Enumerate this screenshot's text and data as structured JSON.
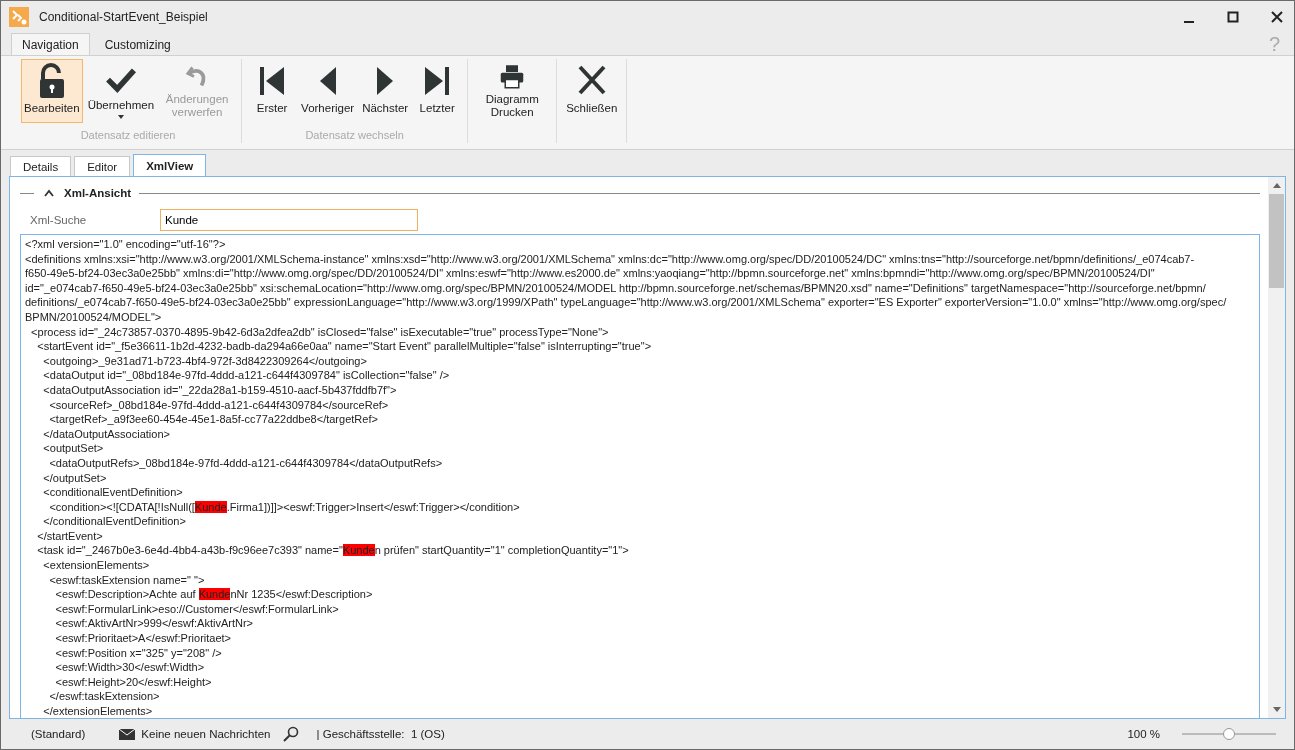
{
  "window": {
    "title": "Conditional-StartEvent_Beispiel"
  },
  "ribbon_tabs": [
    {
      "label": "Navigation",
      "selected": true
    },
    {
      "label": "Customizing",
      "selected": false
    }
  ],
  "help": "?",
  "ribbon_groups": [
    {
      "label": "Datensatz editieren",
      "buttons": [
        {
          "kind": "unlock",
          "label": "Bearbeiten",
          "selected": true,
          "disabled": false,
          "dropdown": false
        },
        {
          "kind": "check",
          "label": "Übernehmen",
          "selected": false,
          "disabled": false,
          "dropdown": true
        },
        {
          "kind": "undo",
          "label": "Änderungen verwerfen",
          "selected": false,
          "disabled": true,
          "dropdown": false
        }
      ]
    },
    {
      "label": "Datensatz wechseln",
      "buttons": [
        {
          "kind": "first",
          "label": "Erster",
          "selected": false,
          "disabled": false,
          "dropdown": false
        },
        {
          "kind": "previous",
          "label": "Vorheriger",
          "selected": false,
          "disabled": false,
          "dropdown": false
        },
        {
          "kind": "next",
          "label": "Nächster",
          "selected": false,
          "disabled": false,
          "dropdown": false
        },
        {
          "kind": "last",
          "label": "Letzter",
          "selected": false,
          "disabled": false,
          "dropdown": false
        }
      ]
    },
    {
      "buttons": [
        {
          "kind": "printer",
          "label": "Diagramm Drucken",
          "selected": false,
          "disabled": false,
          "dropdown": false
        }
      ]
    },
    {
      "buttons": [
        {
          "kind": "close",
          "label": "Schließen",
          "selected": false,
          "disabled": false,
          "dropdown": false
        }
      ]
    }
  ],
  "doc_tabs": [
    {
      "label": "Details",
      "selected": false
    },
    {
      "label": "Editor",
      "selected": false
    },
    {
      "label": "XmlView",
      "selected": true
    }
  ],
  "section": {
    "title": "Xml-Ansicht",
    "expanded": true
  },
  "search": {
    "label": "Xml-Suche",
    "value": "Kunde"
  },
  "xml_lines": [
    [
      {
        "text": "<?xml version=\"1.0\" encoding=\"utf-16\"?>",
        "highlighted": false
      }
    ],
    [
      {
        "text": "<definitions xmlns:xsi=\"http://www.w3.org/2001/XMLSchema-instance\" xmlns:xsd=\"http://www.w3.org/2001/XMLSchema\" xmlns:dc=\"http://www.omg.org/spec/DD/20100524/DC\" xmlns:tns=\"http://sourceforge.net/bpmn/definitions/_e074cab7-",
        "highlighted": false
      }
    ],
    [
      {
        "text": "f650-49e5-bf24-03ec3a0e25bb\" xmlns:di=\"http://www.omg.org/spec/DD/20100524/DI\" xmlns:eswf=\"http://www.es2000.de\" xmlns:yaoqiang=\"http://bpmn.sourceforge.net\" xmlns:bpmndi=\"http://www.omg.org/spec/BPMN/20100524/DI\"",
        "highlighted": false
      }
    ],
    [
      {
        "text": "id=\"_e074cab7-f650-49e5-bf24-03ec3a0e25bb\" xsi:schemaLocation=\"http://www.omg.org/spec/BPMN/20100524/MODEL http://bpmn.sourceforge.net/schemas/BPMN20.xsd\" name=\"Definitions\" targetNamespace=\"http://sourceforge.net/bpmn/",
        "highlighted": false
      }
    ],
    [
      {
        "text": "definitions/_e074cab7-f650-49e5-bf24-03ec3a0e25bb\" expressionLanguage=\"http://www.w3.org/1999/XPath\" typeLanguage=\"http://www.w3.org/2001/XMLSchema\" exporter=\"ES Exporter\" exporterVersion=\"1.0.0\" xmlns=\"http://www.omg.org/spec/",
        "highlighted": false
      }
    ],
    [
      {
        "text": "BPMN/20100524/MODEL\">",
        "highlighted": false
      }
    ],
    [
      {
        "text": "  <process id=\"_24c73857-0370-4895-9b42-6d3a2dfea2db\" isClosed=\"false\" isExecutable=\"true\" processType=\"None\">",
        "highlighted": false
      }
    ],
    [
      {
        "text": "    <startEvent id=\"_f5e36611-1b2d-4232-badb-da294a66e0aa\" name=\"Start Event\" parallelMultiple=\"false\" isInterrupting=\"true\">",
        "highlighted": false
      }
    ],
    [
      {
        "text": "      <outgoing>_9e31ad71-b723-4bf4-972f-3d8422309264</outgoing>",
        "highlighted": false
      }
    ],
    [
      {
        "text": "      <dataOutput id=\"_08bd184e-97fd-4ddd-a121-c644f4309784\" isCollection=\"false\" />",
        "highlighted": false
      }
    ],
    [
      {
        "text": "      <dataOutputAssociation id=\"_22da28a1-b159-4510-aacf-5b437fddfb7f\">",
        "highlighted": false
      }
    ],
    [
      {
        "text": "        <sourceRef>_08bd184e-97fd-4ddd-a121-c644f4309784</sourceRef>",
        "highlighted": false
      }
    ],
    [
      {
        "text": "        <targetRef>_a9f3ee60-454e-45e1-8a5f-cc77a22ddbe8</targetRef>",
        "highlighted": false
      }
    ],
    [
      {
        "text": "      </dataOutputAssociation>",
        "highlighted": false
      }
    ],
    [
      {
        "text": "      <outputSet>",
        "highlighted": false
      }
    ],
    [
      {
        "text": "        <dataOutputRefs>_08bd184e-97fd-4ddd-a121-c644f4309784</dataOutputRefs>",
        "highlighted": false
      }
    ],
    [
      {
        "text": "      </outputSet>",
        "highlighted": false
      }
    ],
    [
      {
        "text": "      <conditionalEventDefinition>",
        "highlighted": false
      }
    ],
    [
      {
        "text": "        <condition><![CDATA[!IsNull([",
        "highlighted": false
      },
      {
        "text": "Kunde",
        "highlighted": true
      },
      {
        "text": ".Firma1])]]><eswf:Trigger>Insert</eswf:Trigger></condition>",
        "highlighted": false
      }
    ],
    [
      {
        "text": "      </conditionalEventDefinition>",
        "highlighted": false
      }
    ],
    [
      {
        "text": "    </startEvent>",
        "highlighted": false
      }
    ],
    [
      {
        "text": "    <task id=\"_2467b0e3-6e4d-4bb4-a43b-f9c96ee7c393\" name=\"",
        "highlighted": false
      },
      {
        "text": "Kunde",
        "highlighted": true
      },
      {
        "text": "n prüfen\" startQuantity=\"1\" completionQuantity=\"1\">",
        "highlighted": false
      }
    ],
    [
      {
        "text": "      <extensionElements>",
        "highlighted": false
      }
    ],
    [
      {
        "text": "        <eswf:taskExtension name=\" \">",
        "highlighted": false
      }
    ],
    [
      {
        "text": "          <eswf:Description>Achte auf ",
        "highlighted": false
      },
      {
        "text": "Kunde",
        "highlighted": true
      },
      {
        "text": "nNr 1235</eswf:Description>",
        "highlighted": false
      }
    ],
    [
      {
        "text": "          <eswf:FormularLink>eso://Customer</eswf:FormularLink>",
        "highlighted": false
      }
    ],
    [
      {
        "text": "          <eswf:AktivArtNr>999</eswf:AktivArtNr>",
        "highlighted": false
      }
    ],
    [
      {
        "text": "          <eswf:Prioritaet>A</eswf:Prioritaet>",
        "highlighted": false
      }
    ],
    [
      {
        "text": "          <eswf:Position x=\"325\" y=\"208\" />",
        "highlighted": false
      }
    ],
    [
      {
        "text": "          <eswf:Width>30</eswf:Width>",
        "highlighted": false
      }
    ],
    [
      {
        "text": "          <eswf:Height>20</eswf:Height>",
        "highlighted": false
      }
    ],
    [
      {
        "text": "        </eswf:taskExtension>",
        "highlighted": false
      }
    ],
    [
      {
        "text": "      </extensionElements>",
        "highlighted": false
      }
    ]
  ],
  "status_bar": {
    "layout": "(Standard)",
    "messages": "Keine neuen Nachrichten",
    "branch": "| Geschäftsstelle:  1 (OS)",
    "zoom": "100 %",
    "zoom_slider": {
      "level": 0.5
    }
  }
}
